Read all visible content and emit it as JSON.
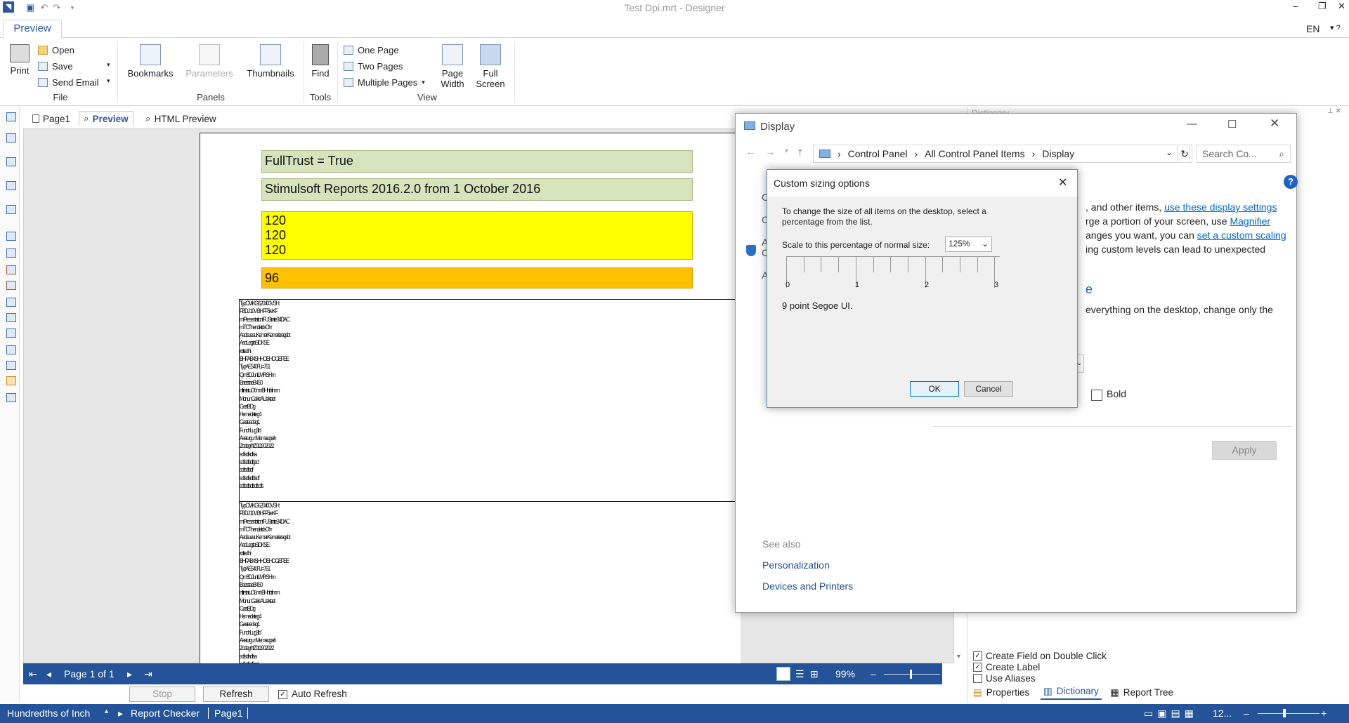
{
  "window": {
    "title": "Test Dpi.mrt - Designer",
    "language": "EN"
  },
  "ribbon": {
    "tab": "Preview",
    "file": {
      "print": "Print",
      "open": "Open",
      "save": "Save",
      "send_email": "Send Email",
      "group": "File"
    },
    "panels": {
      "bookmarks": "Bookmarks",
      "parameters": "Parameters",
      "thumbnails": "Thumbnails",
      "group": "Panels"
    },
    "tools": {
      "find": "Find",
      "group": "Tools"
    },
    "view": {
      "one_page": "One Page",
      "two_pages": "Two Pages",
      "multiple_pages": "Multiple Pages",
      "page_width_1": "Page",
      "page_width_2": "Width",
      "full_screen_1": "Full",
      "full_screen_2": "Screen",
      "group": "View"
    }
  },
  "page_tabs": [
    "Page1",
    "Preview",
    "HTML Preview"
  ],
  "report": {
    "full_trust": "FullTrust = True",
    "version": "Stimulsoft Reports 2016.2.0 from 1 October 2016",
    "dpi_lines": [
      "120",
      "120",
      "120"
    ],
    "dpi_96": "96",
    "text_lines": [
      "TypCMKG6.20400VSH:",
      "FBDJ 10V BHFF5reKF",
      "miPresentationfFUStrate34DAC",
      "mTCThendiatclsOhr",
      "AadisuesuKemarKemarieragsbt",
      "AadLegtaSIDKSE",
      "rotted hi",
      "BHFAB4SHHOEHOGEFEE",
      "TypAE540FLi=751",
      "Qm8DJunlLMRSHm",
      "BaeistaeB4S0",
      "ntfirstatuO6mnBHhibfimm",
      "MonunGakisAUaktaet",
      "GastBDg",
      "Hemedateg4",
      "Gasteadag1",
      "FunchLug3ild",
      "AasturgunMemaugrah",
      "2bdegrhtZ011902022",
      "sdfsdfsdfsa",
      "sdfsdfsdfgsd",
      "sdfsdfsdf",
      "sdfsdfsdfdsdf",
      "sdfsdfsdfsdfsdfs"
    ]
  },
  "nav": {
    "page_label": "Page 1 of 1",
    "zoom": "99%"
  },
  "bottom": {
    "stop": "Stop",
    "refresh": "Refresh",
    "auto_refresh": "Auto Refresh"
  },
  "status": {
    "units": "Hundredths of Inch",
    "checker": "Report Checker",
    "page": "Page1",
    "zoom": "12..."
  },
  "dictionary": {
    "title": "Dictionary",
    "options": [
      "Create Field on Double Click",
      "Create Label",
      "Use Aliases"
    ],
    "tabs": [
      "Properties",
      "Dictionary",
      "Report Tree"
    ]
  },
  "display_window": {
    "title": "Display",
    "breadcrumb": [
      "Control Panel",
      "All Control Panel Items",
      "Display"
    ],
    "search_placeholder": "Search Co...",
    "text1_a": ", and other items,",
    "text1_link": "use these display settings",
    "text2_a": "rge a portion of your screen, use",
    "text2_link": "Magnifier",
    "text3_a": "anges you want, you can",
    "text3_link": "set a custom scaling",
    "text4": "ing custom levels can lead to unexpected",
    "e_letter": "e",
    "text5": "everything on the desktop, change only the",
    "bold": "Bold",
    "apply": "Apply",
    "see_also": "See also",
    "personalization": "Personalization",
    "devices": "Devices and Printers"
  },
  "dialog": {
    "title": "Custom sizing options",
    "desc": "To change the size of all items on the desktop, select a percentage from the list.",
    "scale_label": "Scale to this percentage of normal size:",
    "scale_value": "125%",
    "ruler": [
      "0",
      "1",
      "2",
      "3"
    ],
    "sample": "9 point Segoe UI.",
    "ok": "OK",
    "cancel": "Cancel"
  },
  "colors": {
    "accent": "#24539a",
    "ribbon_blue": "#2b579a",
    "link": "#0066cc"
  }
}
